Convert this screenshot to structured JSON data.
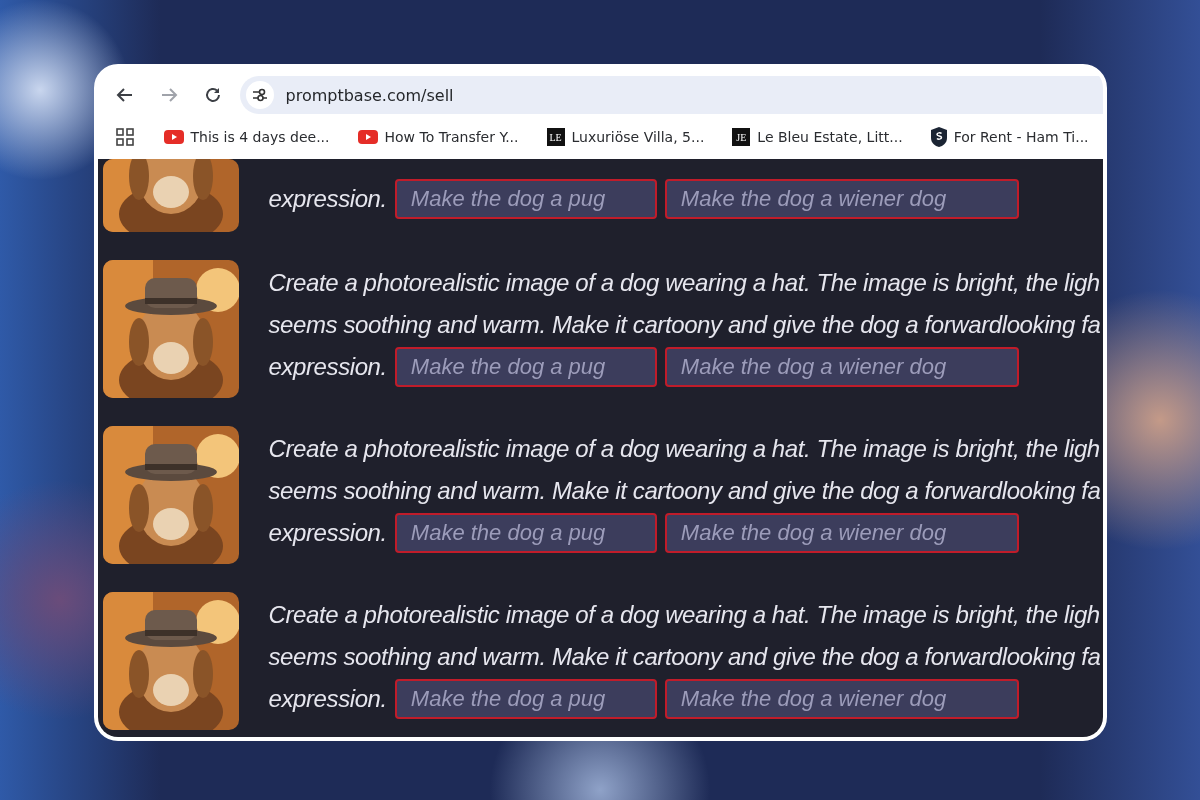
{
  "browser": {
    "url": "promptbase.com/sell",
    "forward_disabled": true
  },
  "bookmarks": [
    {
      "title": "This is 4 days dee...",
      "kind": "video"
    },
    {
      "title": "How To Transfer Y...",
      "kind": "video"
    },
    {
      "title": "Luxuriöse Villa, 5...",
      "kind": "monogram",
      "badge": "LE"
    },
    {
      "title": "Le Bleu Estate, Litt...",
      "kind": "monogram",
      "badge": "JE"
    },
    {
      "title": "For Rent - Ham Ti...",
      "kind": "emblem"
    }
  ],
  "prompts": [
    {
      "last_line": "expression.",
      "variations": [
        {
          "placeholder": "Make the dog a pug"
        },
        {
          "placeholder": "Make the dog a wiener dog"
        }
      ]
    },
    {
      "lines": [
        "Create a photorealistic image of a dog wearing a hat. The image is bright, the ligh",
        "seems soothing and warm. Make it cartoony and give the dog a forwardlooking fa"
      ],
      "last_line": "expression.",
      "variations": [
        {
          "placeholder": "Make the dog a pug"
        },
        {
          "placeholder": "Make the dog a wiener dog"
        }
      ]
    },
    {
      "lines": [
        "Create a photorealistic image of a dog wearing a hat. The image is bright, the ligh",
        "seems soothing and warm. Make it cartoony and give the dog a forwardlooking fa"
      ],
      "last_line": "expression.",
      "variations": [
        {
          "placeholder": "Make the dog a pug"
        },
        {
          "placeholder": "Make the dog a wiener dog"
        }
      ]
    },
    {
      "lines": [
        "Create a photorealistic image of a dog wearing a hat. The image is bright, the ligh",
        "seems soothing and warm. Make it cartoony and give the dog a forwardlooking fa"
      ],
      "last_line": "expression.",
      "variations": [
        {
          "placeholder": "Make the dog a pug"
        },
        {
          "placeholder": "Make the dog a wiener dog"
        }
      ]
    }
  ]
}
